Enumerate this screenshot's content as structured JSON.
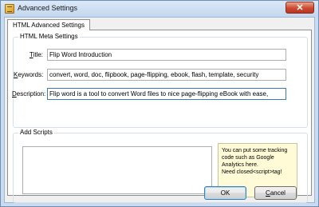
{
  "window": {
    "title": "Advanced Settings",
    "close_glyph": "✕"
  },
  "tab": {
    "label": "HTML Advanced Settings"
  },
  "meta_group": {
    "legend": "HTML Meta Settings",
    "title_label": "Title:",
    "title_value": "Flip Word Introduction",
    "keywords_label": "Keywords:",
    "keywords_value": "convert, word, doc, flipbook, page-flipping, ebook, flash, template, security",
    "description_label": "Description:",
    "description_value": "Flip word is a tool to convert Word files to nice page-flipping eBook with ease,"
  },
  "scripts_group": {
    "legend": "Add Scripts",
    "tip_lines": [
      "You can put some tracking",
      "code such as Google",
      "Analytics here.",
      "Need closed<script>tag!"
    ]
  },
  "buttons": {
    "ok": "OK",
    "cancel": "Cancel"
  },
  "icons": {
    "app": "settings-window-icon",
    "close": "close-icon"
  },
  "colors": {
    "title_bar": "#c3d7ee",
    "close_button": "#cc4a32",
    "tip_background": "#fffbd7"
  }
}
